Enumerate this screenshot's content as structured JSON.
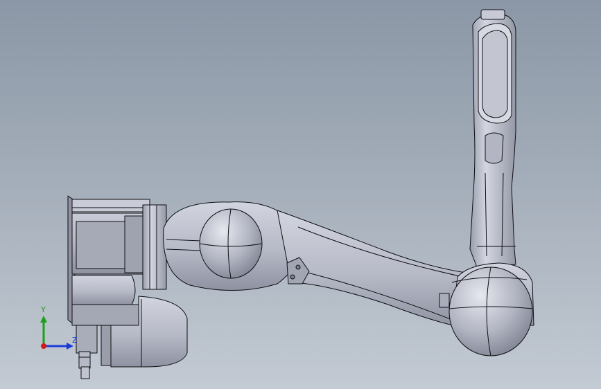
{
  "viewport": {
    "background_top": "#8b97a6",
    "background_bottom": "#c3cad3"
  },
  "model": {
    "body_color": "#b9bcc8",
    "shadow_color": "#7b7f8e",
    "edge_color": "#0d0d12"
  },
  "triad": {
    "x_color": "#d61a1a",
    "y_color": "#1aa01a",
    "z_color": "#1a3ad6",
    "y_label": "Y",
    "z_label": "Z"
  }
}
